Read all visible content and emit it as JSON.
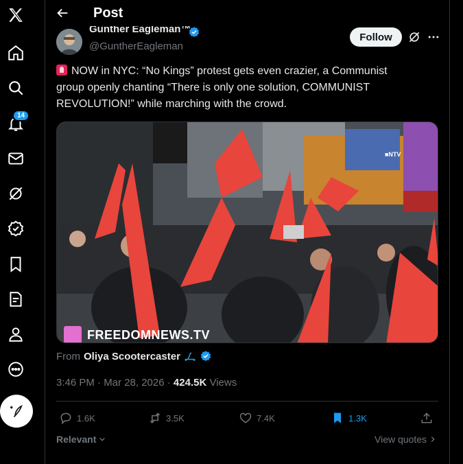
{
  "header": {
    "title": "Post"
  },
  "sidebar": {
    "items": [
      {
        "name": "x-logo-icon"
      },
      {
        "name": "home-icon"
      },
      {
        "name": "search-icon"
      },
      {
        "name": "notifications-icon"
      },
      {
        "name": "messages-icon"
      },
      {
        "name": "grok-icon"
      },
      {
        "name": "verified-orgs-icon"
      },
      {
        "name": "bookmarks-icon"
      },
      {
        "name": "jobs-icon"
      },
      {
        "name": "profile-icon"
      },
      {
        "name": "more-icon"
      }
    ],
    "notification_count": "14",
    "compose_icon": "compose-icon"
  },
  "post": {
    "author_name": "Gunther Eagleman™",
    "handle": "@GuntherEagleman",
    "follow_label": "Follow",
    "text_line1": "NOW in NYC: “No Kings” protest gets even crazier, a Communist group openly chanting “There is only one solution, COMMUNIST REVOLUTION!” while marching with the crowd.",
    "media_watermark": "FREEDOMNEWS.TV",
    "media_corner_logo": "■NTV",
    "from_label": "From",
    "from_name": "Oliya Scootercaster",
    "time": "3:46 PM · Mar 28, 2026 · ",
    "views_count": "424.5K",
    "views_label": " Views",
    "replies": "1.6K",
    "reposts": "3.5K",
    "likes": "7.4K",
    "bookmarks": "1.3K",
    "relevant_label": "Relevant",
    "view_quotes_label": "View quotes"
  },
  "colors": {
    "accent": "#1d9bf0",
    "background": "#000000",
    "text": "#e7e9ea",
    "muted": "#71767b",
    "flag_red": "#e8453c"
  }
}
